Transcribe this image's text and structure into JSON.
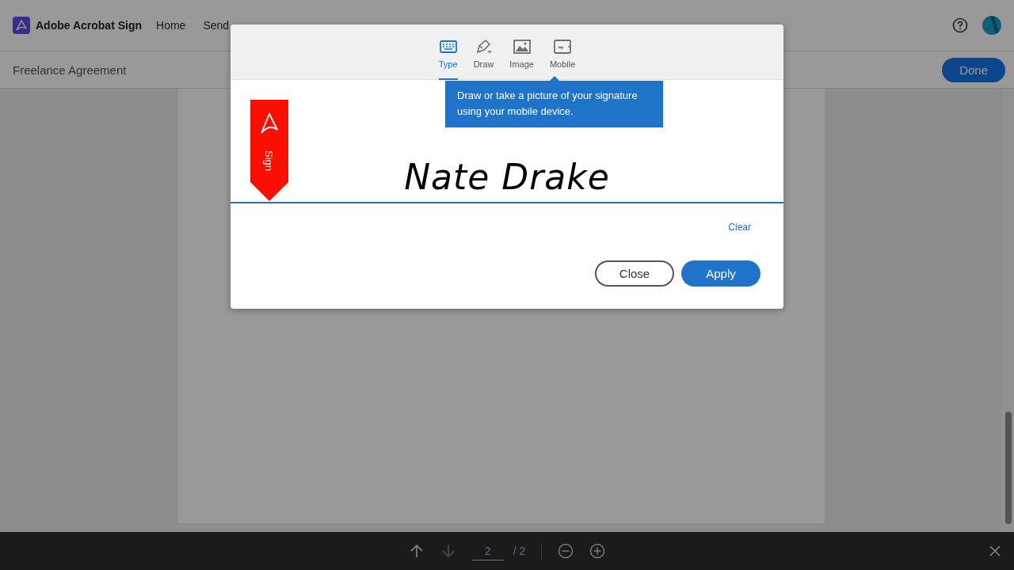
{
  "app": {
    "name": "Adobe Acrobat Sign"
  },
  "nav": [
    {
      "label": "Home"
    },
    {
      "label": "Send"
    }
  ],
  "document": {
    "title": "Freelance Agreement",
    "done_button": "Done"
  },
  "signature_dialog": {
    "tabs": [
      {
        "label": "Type",
        "selected": true
      },
      {
        "label": "Draw",
        "selected": false
      },
      {
        "label": "Image",
        "selected": false
      },
      {
        "label": "Mobile",
        "selected": false
      }
    ],
    "tooltip": "Draw or take a picture of your signature using your mobile device.",
    "ribbon_label": "Sign",
    "signature": "Nate Drake",
    "clear": "Clear",
    "buttons": [
      {
        "label": "Close",
        "kind": "secondary"
      },
      {
        "label": "Apply",
        "kind": "primary"
      }
    ]
  },
  "pager": {
    "arrows": [
      {
        "kind": "up",
        "disabled": false
      },
      {
        "kind": "down",
        "disabled": true
      }
    ],
    "current": "2",
    "total": "/ 2"
  }
}
